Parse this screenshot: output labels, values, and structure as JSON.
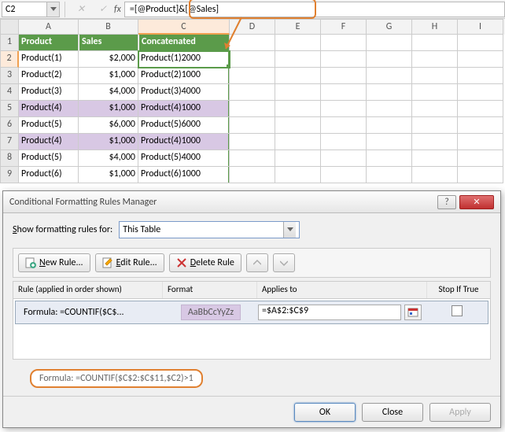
{
  "formula_bar": {
    "cell_ref": "C2",
    "fx_label": "fx",
    "formula": "=[@Product]&[@Sales]"
  },
  "columns": [
    "A",
    "B",
    "C",
    "D",
    "E",
    "F",
    "G",
    "H",
    "I"
  ],
  "table": {
    "headers": [
      "Product",
      "Sales",
      "Concatenated"
    ],
    "rows": [
      {
        "n": "2",
        "product": "Product(1)",
        "sales": "$2,000",
        "concat": "Product(1)2000",
        "dup": false,
        "sel": true
      },
      {
        "n": "3",
        "product": "Product(2)",
        "sales": "$1,000",
        "concat": "Product(2)1000",
        "dup": false
      },
      {
        "n": "4",
        "product": "Product(3)",
        "sales": "$4,000",
        "concat": "Product(3)4000",
        "dup": false
      },
      {
        "n": "5",
        "product": "Product(4)",
        "sales": "$1,000",
        "concat": "Product(4)1000",
        "dup": true
      },
      {
        "n": "6",
        "product": "Product(5)",
        "sales": "$6,000",
        "concat": "Product(5)6000",
        "dup": false
      },
      {
        "n": "7",
        "product": "Product(4)",
        "sales": "$1,000",
        "concat": "Product(4)1000",
        "dup": true
      },
      {
        "n": "8",
        "product": "Product(5)",
        "sales": "$4,000",
        "concat": "Product(5)4000",
        "dup": false
      },
      {
        "n": "9",
        "product": "Product(6)",
        "sales": "$1,000",
        "concat": "Product(6)1000",
        "dup": false
      }
    ]
  },
  "dialog": {
    "title": "Conditional Formatting Rules Manager",
    "show_label": "Show formatting rules for:",
    "show_value": "This Table",
    "buttons": {
      "new": "New Rule...",
      "edit": "Edit Rule...",
      "delete": "Delete Rule"
    },
    "list_headers": {
      "rule": "Rule (applied in order shown)",
      "format": "Format",
      "applies": "Applies to",
      "stop": "Stop If True"
    },
    "rule": {
      "name": "Formula: =COUNTIF($C$...",
      "sample": "AaBbCcYyZz",
      "applies_to": "=$A$2:$C$9"
    },
    "detail": "Formula: =COUNTIF($C$2:$C$11,$C2)>1",
    "footer": {
      "ok": "OK",
      "close": "Close",
      "apply": "Apply"
    }
  }
}
